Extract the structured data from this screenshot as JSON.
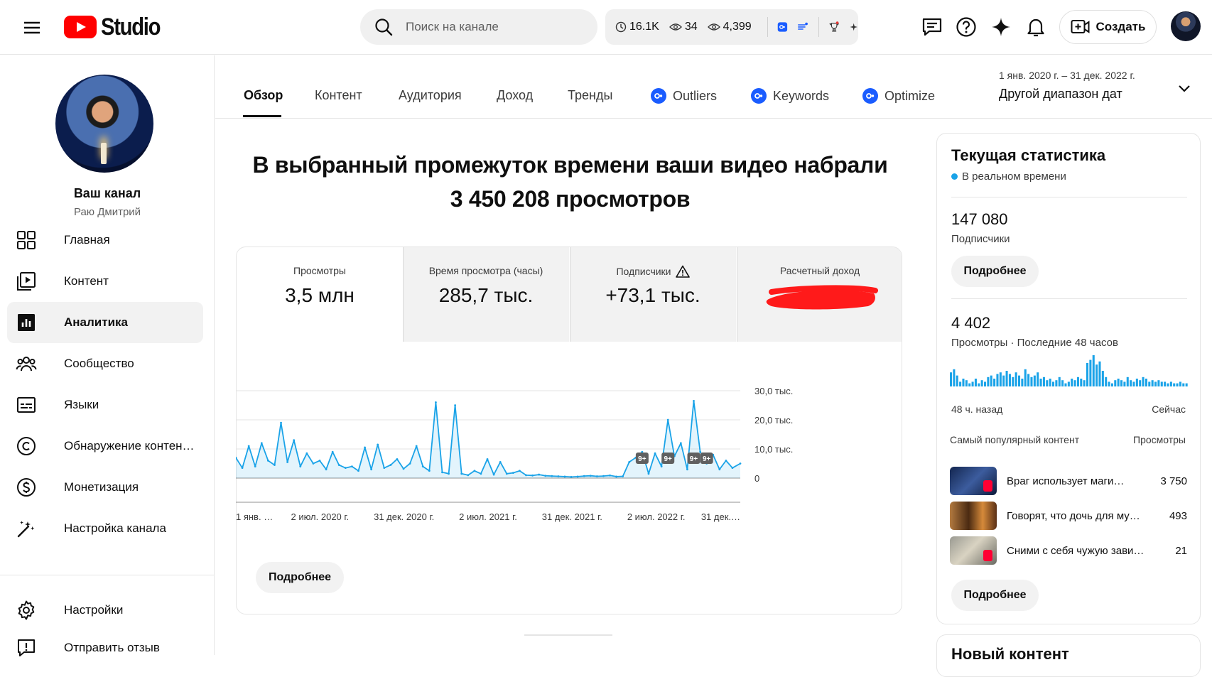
{
  "topbar": {
    "logo_text": "Studio",
    "search_placeholder": "Поиск на канале",
    "ext_stats": {
      "watch": "16.1K",
      "views1": "34",
      "views2": "4,399"
    },
    "create_label": "Создать"
  },
  "sidebar": {
    "channel_name": "Ваш канал",
    "channel_owner": "Раю Дмитрий",
    "items": [
      {
        "label": "Главная",
        "icon": "dashboard-icon"
      },
      {
        "label": "Контент",
        "icon": "content-icon"
      },
      {
        "label": "Аналитика",
        "icon": "analytics-icon",
        "active": true
      },
      {
        "label": "Сообщество",
        "icon": "community-icon"
      },
      {
        "label": "Языки",
        "icon": "subtitles-icon"
      },
      {
        "label": "Обнаружение контен…",
        "icon": "copyright-icon"
      },
      {
        "label": "Монетизация",
        "icon": "monetization-icon"
      },
      {
        "label": "Настройка канала",
        "icon": "customization-icon"
      },
      {
        "label": "Настройки",
        "icon": "gear-icon"
      },
      {
        "label": "Отправить отзыв",
        "icon": "feedback-icon"
      }
    ]
  },
  "tabs": [
    {
      "label": "Обзор",
      "active": true
    },
    {
      "label": "Контент"
    },
    {
      "label": "Аудитория"
    },
    {
      "label": "Доход"
    },
    {
      "label": "Тренды"
    },
    {
      "label": "Outliers",
      "badge": true
    },
    {
      "label": "Keywords",
      "badge": true
    },
    {
      "label": "Optimize",
      "badge": true
    }
  ],
  "date_range": {
    "period": "1 янв. 2020 г. – 31 дек. 2022 г.",
    "label": "Другой диапазон дат"
  },
  "headline": {
    "line1": "В выбранный промежуток времени ваши видео набрали",
    "line2": "3 450 208 просмотров"
  },
  "kpis": [
    {
      "label": "Просмотры",
      "value": "3,5 млн"
    },
    {
      "label": "Время просмотра (часы)",
      "value": "285,7 тыс."
    },
    {
      "label": "Подписчики",
      "value": "+73,1 тыс.",
      "warning": true
    },
    {
      "label": "Расчетный доход",
      "value": "",
      "redacted": true
    }
  ],
  "more_label": "Подробнее",
  "chart_data": {
    "type": "area",
    "series_color": "#1aa3e8",
    "ylim": [
      0,
      30000
    ],
    "y_ticks": [
      {
        "value": 0,
        "label": "0"
      },
      {
        "value": 10000,
        "label": "10,0 тыс."
      },
      {
        "value": 20000,
        "label": "20,0 тыс."
      },
      {
        "value": 30000,
        "label": "30,0 тыс."
      }
    ],
    "x_ticks": [
      "1 янв. …",
      "2 июл. 2020 г.",
      "31 дек. 2020 г.",
      "2 июл. 2021 г.",
      "31 дек. 2021 г.",
      "2 июл. 2022 г.",
      "31 дек.…"
    ],
    "x": [
      "2020-01-01",
      "2020-01-15",
      "2020-01-29",
      "2020-02-12",
      "2020-02-26",
      "2020-03-11",
      "2020-03-25",
      "2020-04-08",
      "2020-04-22",
      "2020-05-06",
      "2020-05-20",
      "2020-06-03",
      "2020-06-17",
      "2020-07-01",
      "2020-07-15",
      "2020-07-29",
      "2020-08-12",
      "2020-08-26",
      "2020-09-09",
      "2020-09-23",
      "2020-10-07",
      "2020-10-21",
      "2020-11-04",
      "2020-11-18",
      "2020-12-02",
      "2020-12-16",
      "2020-12-30",
      "2021-01-13",
      "2021-01-27",
      "2021-02-10",
      "2021-02-24",
      "2021-03-10",
      "2021-03-24",
      "2021-04-07",
      "2021-04-21",
      "2021-05-05",
      "2021-05-19",
      "2021-06-02",
      "2021-06-16",
      "2021-06-30",
      "2021-07-14",
      "2021-07-28",
      "2021-08-11",
      "2021-08-25",
      "2021-09-08",
      "2021-09-22",
      "2021-10-06",
      "2021-10-20",
      "2021-11-03",
      "2021-11-17",
      "2021-12-01",
      "2021-12-15",
      "2021-12-29",
      "2022-01-12",
      "2022-01-26",
      "2022-02-09",
      "2022-02-23",
      "2022-03-09",
      "2022-03-23",
      "2022-04-06",
      "2022-04-20",
      "2022-05-04",
      "2022-05-18",
      "2022-06-01",
      "2022-06-15",
      "2022-06-29",
      "2022-07-13",
      "2022-07-27",
      "2022-08-10",
      "2022-08-24",
      "2022-09-07",
      "2022-09-21",
      "2022-10-05",
      "2022-10-19",
      "2022-11-02",
      "2022-11-16",
      "2022-11-30",
      "2022-12-14",
      "2022-12-31"
    ],
    "values": [
      7000,
      3500,
      11000,
      4000,
      12000,
      6000,
      4500,
      19000,
      5500,
      13000,
      4000,
      8500,
      5000,
      6000,
      3000,
      9000,
      4500,
      3500,
      4000,
      2500,
      10500,
      3000,
      11500,
      3500,
      4500,
      6500,
      3200,
      5000,
      11000,
      4000,
      2500,
      26000,
      2000,
      1500,
      25000,
      1500,
      1000,
      2500,
      1500,
      6500,
      1200,
      5500,
      1500,
      1800,
      2500,
      1000,
      900,
      1200,
      800,
      700,
      600,
      500,
      400,
      500,
      700,
      800,
      600,
      700,
      900,
      500,
      600,
      5500,
      7000,
      9000,
      1500,
      8500,
      4000,
      20000,
      7500,
      12000,
      3000,
      26500,
      9000,
      5000,
      8000,
      3000,
      6000,
      3500,
      5000
    ],
    "annotations": [
      {
        "x": "2022-06-01",
        "label": "9+"
      },
      {
        "x": "2022-07-27",
        "label": "9+"
      },
      {
        "x": "2022-09-21",
        "label": "9+"
      },
      {
        "x": "2022-10-19",
        "label": "9+"
      }
    ]
  },
  "realtime": {
    "title": "Текущая статистика",
    "live_label": "В реальном времени",
    "subscribers_value": "147 080",
    "subscribers_label": "Подписчики",
    "views_value": "4 402",
    "views_label": "Просмотры · Последние 48 часов",
    "axis_left": "48 ч. назад",
    "axis_right": "Сейчас",
    "bars": [
      9,
      11,
      7,
      3,
      5,
      4,
      2,
      3,
      5,
      2,
      4,
      3,
      6,
      7,
      5,
      8,
      9,
      7,
      10,
      8,
      6,
      9,
      7,
      5,
      11,
      8,
      6,
      7,
      9,
      5,
      6,
      4,
      5,
      3,
      4,
      6,
      4,
      2,
      3,
      5,
      4,
      6,
      5,
      4,
      15,
      17,
      20,
      14,
      16,
      10,
      6,
      3,
      2,
      4,
      5,
      4,
      3,
      6,
      4,
      3,
      5,
      4,
      6,
      5,
      3,
      4,
      3,
      4,
      3,
      3,
      2,
      3,
      2,
      2,
      3,
      2,
      2
    ],
    "top_content_label": "Самый популярный контент",
    "top_content_col": "Просмотры",
    "top_content": [
      {
        "title": "Враг использует маги…",
        "views": "3 750"
      },
      {
        "title": "Говорят, что дочь для му…",
        "views": "493"
      },
      {
        "title": "Сними с себя чужую зави…",
        "views": "21"
      }
    ]
  },
  "new_content": {
    "title": "Новый контент"
  }
}
